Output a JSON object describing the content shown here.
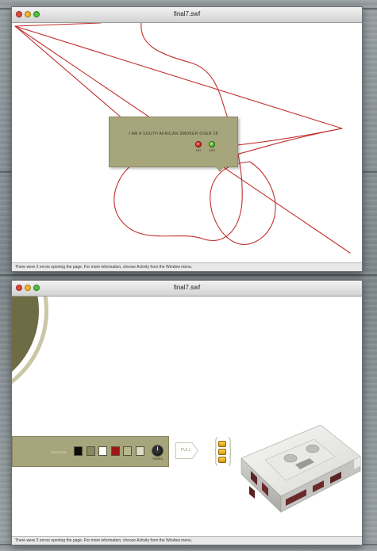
{
  "window_top": {
    "title": "final7.swf",
    "status_text": "There were 2 errors opening the page. For more information, choose Activity from the Window menu.",
    "dialog": {
      "question": "I AM A SOUTH AFRICAN SMOKER OVER 18",
      "no_label": "NO",
      "yes_label": "YES"
    }
  },
  "window_bottom": {
    "title": "final7.swf",
    "status_text": "There were 2 errors opening the page. For more information, choose Activity from the Window menu.",
    "panel": {
      "photos_label": "PHOTOS",
      "tempo_label": "TEMPO",
      "swatches": [
        {
          "name": "black",
          "color": "#0d0d0d"
        },
        {
          "name": "olive",
          "color": "#8a8860"
        },
        {
          "name": "white",
          "color": "#ffffff"
        },
        {
          "name": "red",
          "color": "#9b1616"
        },
        {
          "name": "khaki",
          "color": "#b9b78f"
        },
        {
          "name": "cream",
          "color": "#dcdbc4"
        }
      ]
    },
    "pull_label": "PULL"
  },
  "colors": {
    "panel_olive": "#a7a57c",
    "scribble_red": "#c0302c",
    "arc_dark": "#6e6c45",
    "arc_light": "#c9c7a4",
    "button_amber": "#f0b52a"
  },
  "icons": [
    "close-light-icon",
    "minimize-light-icon",
    "zoom-light-icon",
    "no-button-icon",
    "yes-button-icon",
    "tempo-knob-icon",
    "cassette-tape-icon"
  ]
}
